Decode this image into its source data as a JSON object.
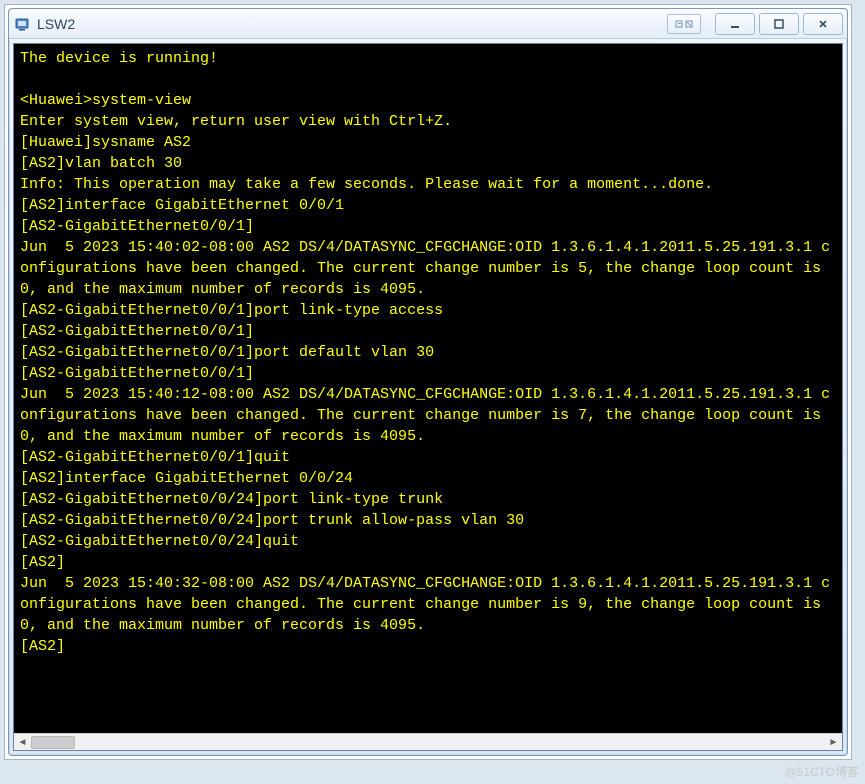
{
  "window": {
    "title": "LSW2"
  },
  "terminal": {
    "lines": [
      "The device is running!",
      "",
      "<Huawei>system-view",
      "Enter system view, return user view with Ctrl+Z.",
      "[Huawei]sysname AS2",
      "[AS2]vlan batch 30",
      "Info: This operation may take a few seconds. Please wait for a moment...done.",
      "[AS2]interface GigabitEthernet 0/0/1",
      "[AS2-GigabitEthernet0/0/1]",
      "Jun  5 2023 15:40:02-08:00 AS2 DS/4/DATASYNC_CFGCHANGE:OID 1.3.6.1.4.1.2011.5.25.191.3.1 configurations have been changed. The current change number is 5, the change loop count is 0, and the maximum number of records is 4095.",
      "[AS2-GigabitEthernet0/0/1]port link-type access",
      "[AS2-GigabitEthernet0/0/1]",
      "[AS2-GigabitEthernet0/0/1]port default vlan 30",
      "[AS2-GigabitEthernet0/0/1]",
      "Jun  5 2023 15:40:12-08:00 AS2 DS/4/DATASYNC_CFGCHANGE:OID 1.3.6.1.4.1.2011.5.25.191.3.1 configurations have been changed. The current change number is 7, the change loop count is 0, and the maximum number of records is 4095.",
      "[AS2-GigabitEthernet0/0/1]quit",
      "[AS2]interface GigabitEthernet 0/0/24",
      "[AS2-GigabitEthernet0/0/24]port link-type trunk",
      "[AS2-GigabitEthernet0/0/24]port trunk allow-pass vlan 30",
      "[AS2-GigabitEthernet0/0/24]quit",
      "[AS2]",
      "Jun  5 2023 15:40:32-08:00 AS2 DS/4/DATASYNC_CFGCHANGE:OID 1.3.6.1.4.1.2011.5.25.191.3.1 configurations have been changed. The current change number is 9, the change loop count is 0, and the maximum number of records is 4095.",
      "[AS2]"
    ]
  },
  "watermark": "@51CTO博客"
}
